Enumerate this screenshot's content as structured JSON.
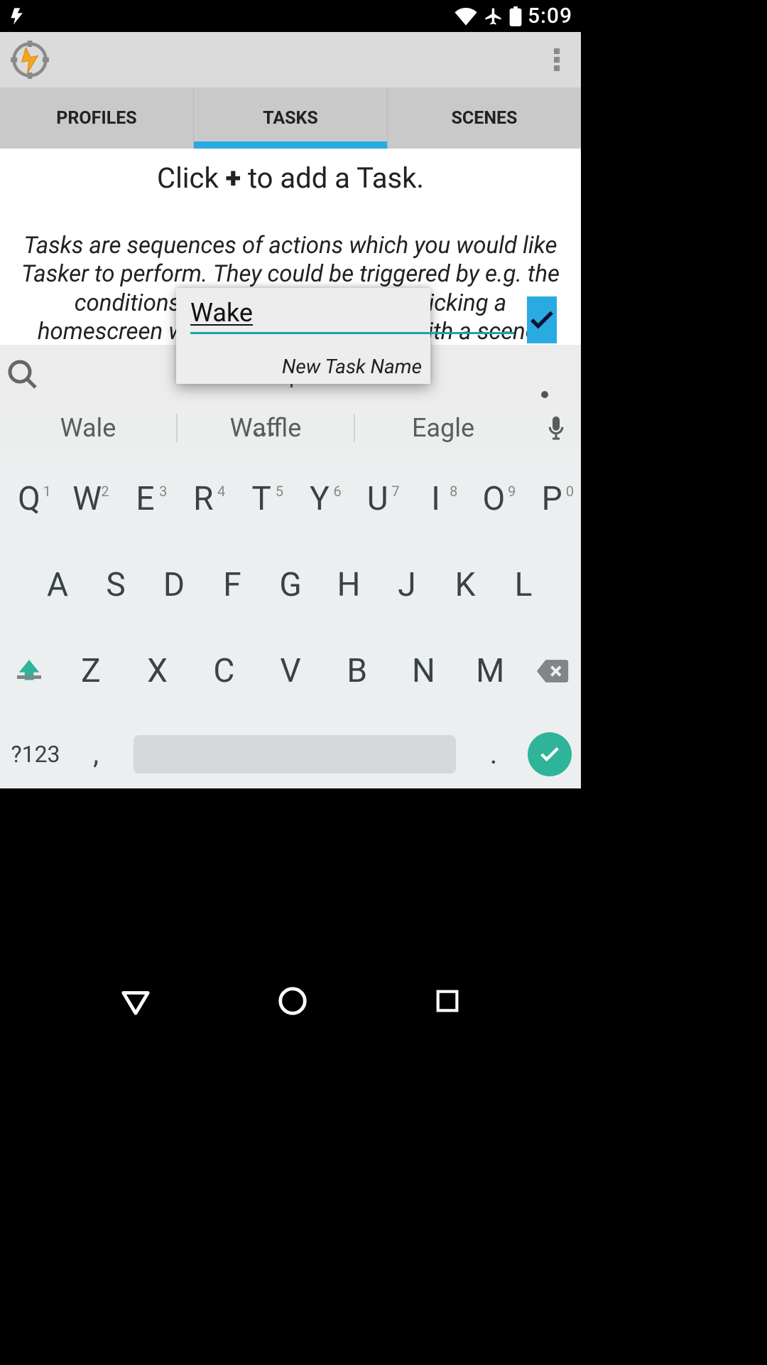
{
  "statusbar": {
    "time": "5:09"
  },
  "tabs": {
    "profiles": "PROFILES",
    "tasks": "TASKS",
    "scenes": "SCENES"
  },
  "hint": {
    "title_pre": "Click ",
    "title_plus": "+",
    "title_post": " to add a Task.",
    "body": "Tasks are sequences of actions which you would like Tasker to perform. They could be triggered by e.g. the conditions of a profile being met, clicking a homescreen widget or by interacting with a scene."
  },
  "dialog": {
    "input_value": "Wake",
    "caption": "New Task Name"
  },
  "suggestions": {
    "s1": "Wale",
    "s2": "Waffle",
    "s3": "Eagle",
    "ellipsis": "•••"
  },
  "keyboard": {
    "row1": [
      {
        "k": "Q",
        "n": "1"
      },
      {
        "k": "W",
        "n": "2"
      },
      {
        "k": "E",
        "n": "3"
      },
      {
        "k": "R",
        "n": "4"
      },
      {
        "k": "T",
        "n": "5"
      },
      {
        "k": "Y",
        "n": "6"
      },
      {
        "k": "U",
        "n": "7"
      },
      {
        "k": "I",
        "n": "8"
      },
      {
        "k": "O",
        "n": "9"
      },
      {
        "k": "P",
        "n": "0"
      }
    ],
    "row2": [
      "A",
      "S",
      "D",
      "F",
      "G",
      "H",
      "J",
      "K",
      "L"
    ],
    "row3": [
      "Z",
      "X",
      "C",
      "V",
      "B",
      "N",
      "M"
    ],
    "sym": "?123",
    "comma": ",",
    "period": "."
  }
}
